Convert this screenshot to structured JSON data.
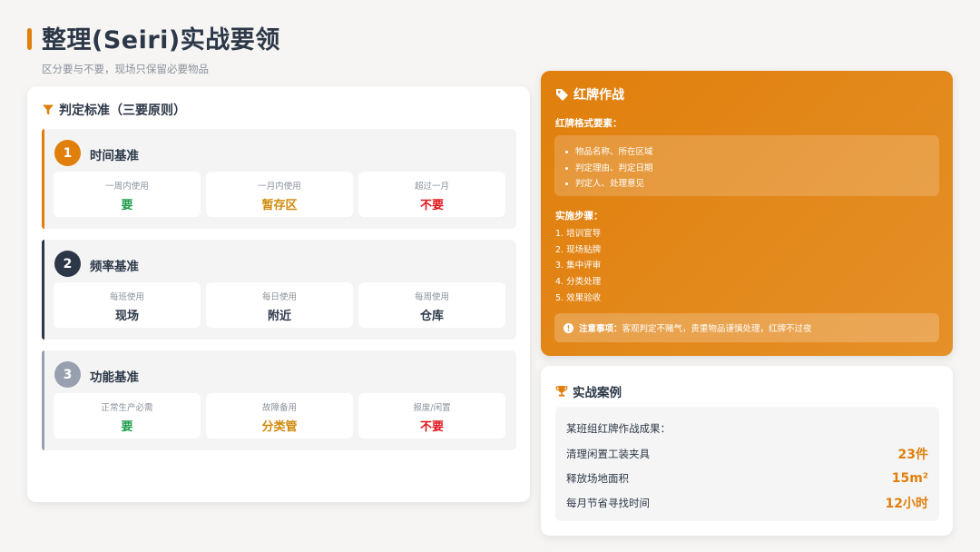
{
  "header": {
    "title": "整理(Seiri)实战要领",
    "subtitle": "区分要与不要，现场只保留必要物品"
  },
  "criteria": {
    "heading": "判定标准（三要原则）",
    "icon": "filter-icon",
    "blocks": [
      {
        "number": "1",
        "title": "时间基准",
        "accent": "#e07f0c",
        "cells": [
          {
            "label": "一周内使用",
            "value": "要",
            "color": "#1f9d4c"
          },
          {
            "label": "一月内使用",
            "value": "暂存区",
            "color": "#d08a0b"
          },
          {
            "label": "超过一月",
            "value": "不要",
            "color": "#e0151b"
          }
        ]
      },
      {
        "number": "2",
        "title": "频率基准",
        "accent": "#2c3848",
        "cells": [
          {
            "label": "每班使用",
            "value": "现场",
            "color": "#2c3848"
          },
          {
            "label": "每日使用",
            "value": "附近",
            "color": "#2c3848"
          },
          {
            "label": "每周使用",
            "value": "仓库",
            "color": "#2c3848"
          }
        ]
      },
      {
        "number": "3",
        "title": "功能基准",
        "accent": "#98a0b0",
        "cells": [
          {
            "label": "正常生产必需",
            "value": "要",
            "color": "#1f9d4c"
          },
          {
            "label": "故障备用",
            "value": "分类管",
            "color": "#d08a0b"
          },
          {
            "label": "报废/闲置",
            "value": "不要",
            "color": "#e0151b"
          }
        ]
      }
    ]
  },
  "red_tag": {
    "heading": "红牌作战",
    "icon": "tag-icon",
    "format_title": "红牌格式要素：",
    "format_items": [
      "物品名称、所在区域",
      "判定理由、判定日期",
      "判定人、处理意见"
    ],
    "steps_title": "实施步骤：",
    "steps": [
      "1. 培训宣导",
      "2. 现场贴牌",
      "3. 集中评审",
      "4. 分类处理",
      "5. 效果验收"
    ],
    "notice_label": "注意事项：",
    "notice_text": "客观判定不赌气，贵重物品谨慎处理，红牌不过夜"
  },
  "case": {
    "heading": "实战案例",
    "icon": "trophy-icon",
    "intro": "某班组红牌作战成果：",
    "rows": [
      {
        "label": "清理闲置工装夹具",
        "value": "23件"
      },
      {
        "label": "释放场地面积",
        "value": "15m²"
      },
      {
        "label": "每月节省寻找时间",
        "value": "12小时"
      }
    ]
  },
  "colors": {
    "accent": "#e07f0c",
    "dark": "#2c3848",
    "green": "#1f9d4c",
    "red": "#e0151b"
  }
}
